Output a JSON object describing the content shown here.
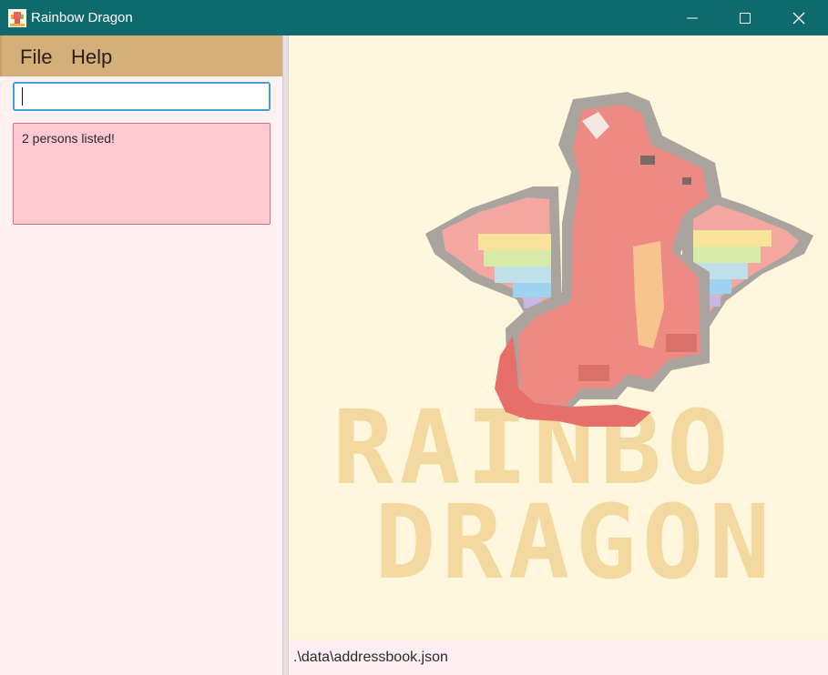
{
  "window": {
    "title": "Rainbow Dragon",
    "titlebar_color": "#0e6a6c",
    "controls": [
      "minimize-icon",
      "maximize-icon",
      "close-icon"
    ]
  },
  "menu": {
    "items": [
      {
        "label": "File"
      },
      {
        "label": "Help"
      }
    ],
    "background": "#d3b07a"
  },
  "command": {
    "value": "",
    "placeholder": ""
  },
  "result": {
    "message": "2 persons listed!",
    "background": "#ffc9d1"
  },
  "logo": {
    "line1": "RAINBO",
    "line2": "DRAGON",
    "text_color": "#f3d9a0"
  },
  "status": {
    "file_path": ".\\data\\addressbook.json"
  },
  "colors": {
    "left_panel_bg": "#fff0f2",
    "right_panel_bg": "#fff7dd",
    "command_border": "#3ea3d8"
  }
}
